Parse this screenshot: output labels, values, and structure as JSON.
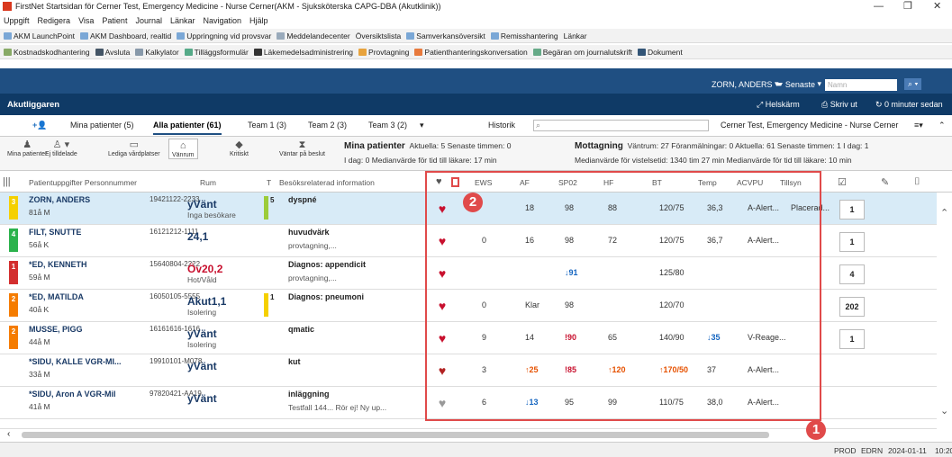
{
  "window": {
    "title": "FirstNet Startsidan för Cerner Test, Emergency Medicine - Nurse Cerner(AKM - Sjuksköterska CAPG-DBA (Akutklinik))",
    "min": "—",
    "max": "❐",
    "close": "✕"
  },
  "menu": [
    "Uppgift",
    "Redigera",
    "Visa",
    "Patient",
    "Journal",
    "Länkar",
    "Navigation",
    "Hjälp"
  ],
  "toolbar1": [
    "AKM LaunchPoint",
    "AKM Dashboard, realtid",
    "Uppringning vid provsvar",
    "Meddelandecenter",
    "Översiktslista",
    "Samverkansöversikt",
    "Remisshantering",
    "Länkar"
  ],
  "toolbar2": [
    "Kostnadskodhantering",
    "Avsluta",
    "Kalkylator",
    "Tilläggsformulär",
    "Läkemedelsadministrering",
    "Provtagning",
    "Patienthanteringskonversation",
    "Begäran om journalutskrift",
    "Dokument"
  ],
  "nav": {
    "user": "ZORN, ANDERS",
    "recent": "Senaste",
    "search_placeholder": "Namn",
    "page_title": "Akutliggaren",
    "fullscreen": "Helskärm",
    "print": "Skriv ut",
    "refresh": "0 minuter sedan"
  },
  "tabs": [
    "Mina patienter (5)",
    "Alla patienter (61)",
    "Team 1 (3)",
    "Team 2 (3)",
    "Team 3 (2)",
    "Historik"
  ],
  "context": "Cerner Test, Emergency Medicine - Nurse Cerner",
  "filters": [
    "Mina patienter",
    "Ej tilldelade",
    "Lediga vårdplatser",
    "Vänrum",
    "Kritiskt",
    "Väntar på beslut"
  ],
  "summary": {
    "my_title": "Mina patienter",
    "my_line1": "Aktuella: 5  Senaste timmen: 0",
    "my_line2": "I dag: 0  Medianvärde för tid till läkare: 17 min",
    "rec_title": "Mottagning",
    "rec_line1": "Väntrum: 27  Föranmälningar: 0  Aktuella: 61  Senaste timmen: 1  I dag: 1",
    "rec_line2": "Medianvärde för vistelsetid: 1340 tim 27 min  Medianvärde för tid till läkare: 10 min"
  },
  "headers": {
    "patient": "Patientuppgifter  Personnummer",
    "room": "Rum",
    "t": "T",
    "visit": "Besöksrelaterad information",
    "ews": "EWS",
    "af": "AF",
    "spo2": "SP02",
    "hf": "HF",
    "bt": "BT",
    "temp": "Temp",
    "acvpu": "ACVPU",
    "tillsyn": "Tillsyn"
  },
  "rows": [
    {
      "prio": "3",
      "prio_color": "#f5d000",
      "name": "ZORN, ANDERS",
      "info": "81å M",
      "pnr": "19421122-2233",
      "room": "yVänt",
      "room_sub": "Inga besökare",
      "room_red": false,
      "t_color": "#9ccc3a",
      "t_num": "5",
      "visit": "dyspné",
      "visit2": "",
      "heart": "#c8102e",
      "ews": "",
      "af": "18",
      "spo2": "98",
      "hf": "88",
      "bt": "120/75",
      "temp": "36,3",
      "acvpu": "A-Alert...",
      "tillsyn": "Placerad...",
      "box": "1",
      "sel": true
    },
    {
      "prio": "4",
      "prio_color": "#2bb24c",
      "name": "FILT, SNUTTE",
      "info": "56å K",
      "pnr": "16121212-1111",
      "room": "24,1",
      "room_sub": "",
      "room_red": false,
      "t_color": "",
      "t_num": "",
      "visit": "huvudvärk",
      "visit2": "provtagning,...",
      "heart": "#c8102e",
      "ews": "0",
      "af": "16",
      "spo2": "98",
      "hf": "72",
      "bt": "120/75",
      "temp": "36,7",
      "acvpu": "A-Alert...",
      "tillsyn": "",
      "box": "1",
      "sel": false
    },
    {
      "prio": "1",
      "prio_color": "#d32f2f",
      "name": "*ED, KENNETH",
      "info": "59å M",
      "pnr": "15640804-2222",
      "room": "Öv20,2",
      "room_sub": "Hot/Våld",
      "room_red": true,
      "t_color": "",
      "t_num": "",
      "visit": "Diagnos: appendicit",
      "visit2": "provtagning,...",
      "heart": "#c8102e",
      "ews": "",
      "af": "",
      "spo2": "↓91",
      "hf": "",
      "bt": "125/80",
      "temp": "",
      "acvpu": "",
      "tillsyn": "",
      "box": "4",
      "sel": false
    },
    {
      "prio": "2",
      "prio_color": "#f57c00",
      "name": "*ED, MATILDA",
      "info": "40å K",
      "pnr": "16050105-5555",
      "room": "Akut1,1",
      "room_sub": "Isolering",
      "room_red": false,
      "t_color": "#f5d000",
      "t_num": "1",
      "visit": "Diagnos: pneumoni",
      "visit2": "",
      "heart": "#c8102e",
      "ews": "0",
      "af": "Klar",
      "spo2": "98",
      "hf": "",
      "bt": "120/70",
      "temp": "",
      "acvpu": "",
      "tillsyn": "",
      "box": "202",
      "sel": false
    },
    {
      "prio": "2",
      "prio_color": "#f57c00",
      "name": "MUSSE, PIGG",
      "info": "44å M",
      "pnr": "16161616-1616",
      "room": "yVänt",
      "room_sub": "Isolering",
      "room_red": false,
      "t_color": "",
      "t_num": "",
      "visit": "qmatic",
      "visit2": "",
      "heart": "#c8102e",
      "ews": "9",
      "af": "14",
      "spo2": "!90",
      "hf": "65",
      "bt": "140/90",
      "temp": "↓35",
      "acvpu": "V-Reage...",
      "tillsyn": "",
      "box": "1",
      "sel": false
    },
    {
      "prio": "",
      "prio_color": "",
      "name": "*SIDU, KALLE VGR-MI...",
      "info": "33å M",
      "pnr": "19910101-M078",
      "room": "yVänt",
      "room_sub": "",
      "room_red": false,
      "t_color": "",
      "t_num": "",
      "visit": "kut",
      "visit2": "",
      "heart": "#b22222",
      "ews": "3",
      "af": "↑25",
      "spo2": "!85",
      "hf": "↑120",
      "bt": "↑170/50",
      "temp": "37",
      "acvpu": "A-Alert...",
      "tillsyn": "",
      "box": "",
      "sel": false
    },
    {
      "prio": "",
      "prio_color": "",
      "name": "*SIDU, Aron A VGR-Mil",
      "info": "41å M",
      "pnr": "97820421-AA19",
      "room": "yVänt",
      "room_sub": "",
      "room_red": false,
      "t_color": "",
      "t_num": "",
      "visit": "inläggning",
      "visit2": "Testfall 144...  Rör ej! Ny up...",
      "heart": "#999999",
      "ews": "6",
      "af": "↓13",
      "spo2": "95",
      "hf": "99",
      "bt": "110/75",
      "temp": "38,0",
      "acvpu": "A-Alert...",
      "tillsyn": "",
      "box": "",
      "sel": false
    }
  ],
  "annotations": [
    "1",
    "2"
  ],
  "status": [
    "PROD",
    "EDRN",
    "2024-01-11",
    "10:20"
  ]
}
